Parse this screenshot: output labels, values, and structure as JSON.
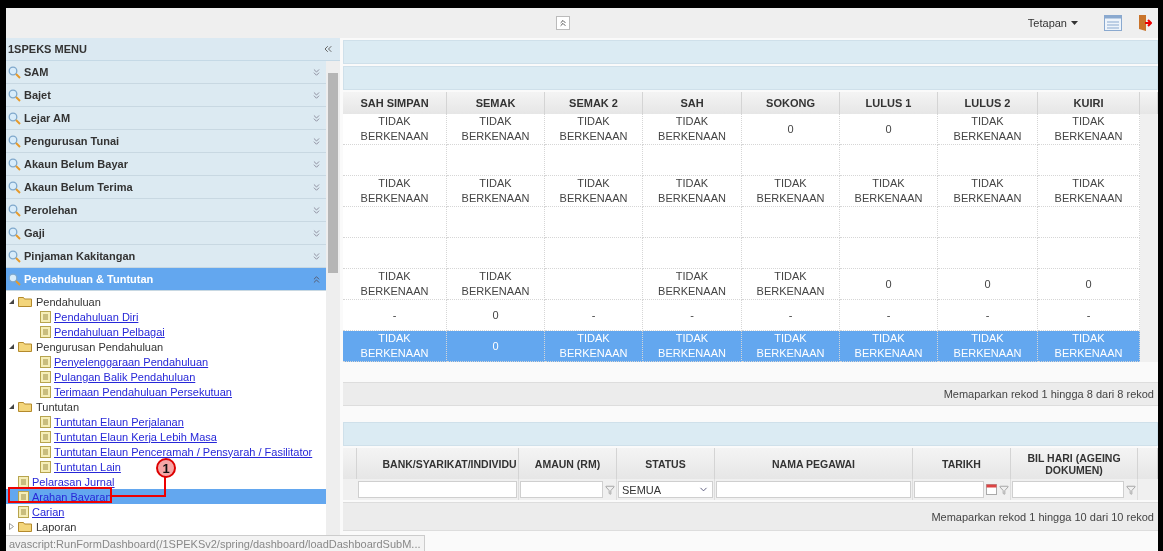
{
  "topbar": {
    "settings_label": "Tetapan"
  },
  "sidebar": {
    "title": "1SPEKS MENU",
    "menu": [
      {
        "label": "SAM",
        "expanded": false
      },
      {
        "label": "Bajet",
        "expanded": false
      },
      {
        "label": "Lejar AM",
        "expanded": false
      },
      {
        "label": "Pengurusan Tunai",
        "expanded": false
      },
      {
        "label": "Akaun Belum Bayar",
        "expanded": false
      },
      {
        "label": "Akaun Belum Terima",
        "expanded": false
      },
      {
        "label": "Perolehan",
        "expanded": false
      },
      {
        "label": "Gaji",
        "expanded": false
      },
      {
        "label": "Pinjaman Kakitangan",
        "expanded": false
      },
      {
        "label": "Pendahuluan & Tuntutan",
        "expanded": true
      }
    ],
    "tree": [
      {
        "kind": "folder",
        "label": "Pendahuluan",
        "expanded": true,
        "children": [
          {
            "kind": "page",
            "label": "Pendahuluan Diri",
            "selected": false,
            "annotated": false
          },
          {
            "kind": "page",
            "label": "Pendahuluan Pelbagai",
            "selected": false,
            "annotated": false
          }
        ]
      },
      {
        "kind": "folder",
        "label": "Pengurusan Pendahuluan",
        "expanded": true,
        "children": [
          {
            "kind": "page",
            "label": "Penyelenggaraan Pendahuluan",
            "selected": false,
            "annotated": false
          },
          {
            "kind": "page",
            "label": "Pulangan Balik Pendahuluan",
            "selected": false,
            "annotated": false
          },
          {
            "kind": "page",
            "label": "Terimaan Pendahuluan Persekutuan",
            "selected": false,
            "annotated": false
          }
        ]
      },
      {
        "kind": "folder",
        "label": "Tuntutan",
        "expanded": true,
        "children": [
          {
            "kind": "page",
            "label": "Tuntutan Elaun Perjalanan",
            "selected": false,
            "annotated": false
          },
          {
            "kind": "page",
            "label": "Tuntutan Elaun Kerja Lebih Masa",
            "selected": false,
            "annotated": false
          },
          {
            "kind": "page",
            "label": "Tuntutan Elaun Penceramah / Pensyarah / Fasilitator",
            "selected": false,
            "annotated": false
          },
          {
            "kind": "page",
            "label": "Tuntutan Lain",
            "selected": false,
            "annotated": false
          }
        ]
      },
      {
        "kind": "page",
        "label": "Pelarasan Jurnal",
        "selected": false,
        "annotated": false
      },
      {
        "kind": "page",
        "label": "Arahan Bayaran",
        "selected": true,
        "annotated": true
      },
      {
        "kind": "page",
        "label": "Carian",
        "selected": false,
        "annotated": false
      },
      {
        "kind": "folder",
        "label": "Laporan",
        "expanded": false
      }
    ],
    "annotation_label": "1",
    "status_text": "avascript:RunFormDashboard(/1SPEKSv2/spring/dashboard/loadDashboardSubM..."
  },
  "table1": {
    "columns": [
      "SAH SIMPAN",
      "SEMAK",
      "SEMAK 2",
      "SAH",
      "SOKONG",
      "LULUS 1",
      "LULUS 2",
      "KUIRI"
    ],
    "rows": [
      {
        "selected": false,
        "cells": [
          "TIDAK BERKENAAN",
          "TIDAK BERKENAAN",
          "TIDAK BERKENAAN",
          "TIDAK BERKENAAN",
          "0",
          "0",
          "TIDAK BERKENAAN",
          "TIDAK BERKENAAN"
        ]
      },
      {
        "selected": false,
        "cells": [
          null,
          null,
          null,
          null,
          null,
          null,
          null,
          null
        ]
      },
      {
        "selected": false,
        "cells": [
          "TIDAK BERKENAAN",
          "TIDAK BERKENAAN",
          "TIDAK BERKENAAN",
          "TIDAK BERKENAAN",
          "TIDAK BERKENAAN",
          "TIDAK BERKENAAN",
          "TIDAK BERKENAAN",
          "TIDAK BERKENAAN"
        ]
      },
      {
        "selected": false,
        "cells": [
          null,
          null,
          null,
          null,
          null,
          null,
          null,
          null
        ]
      },
      {
        "selected": false,
        "cells": [
          null,
          null,
          null,
          null,
          null,
          null,
          null,
          null
        ]
      },
      {
        "selected": false,
        "cells": [
          "TIDAK BERKENAAN",
          "TIDAK BERKENAAN",
          null,
          "TIDAK BERKENAAN",
          "TIDAK BERKENAAN",
          "0",
          "0",
          "0"
        ]
      },
      {
        "selected": false,
        "cells": [
          "-",
          "0",
          "-",
          "-",
          "-",
          "-",
          "-",
          "-"
        ]
      },
      {
        "selected": true,
        "cells": [
          "TIDAK BERKENAAN",
          "0",
          "TIDAK BERKENAAN",
          "TIDAK BERKENAAN",
          "TIDAK BERKENAAN",
          "TIDAK BERKENAAN",
          "TIDAK BERKENAAN",
          "TIDAK BERKENAAN"
        ]
      }
    ],
    "footer": "Memaparkan rekod 1 hingga 8 dari 8 rekod"
  },
  "table2": {
    "columns": [
      "BANK/SYARIKAT/INDIVIDU",
      "AMAUN (RM)",
      "STATUS",
      "NAMA PEGAWAI",
      "TARIKH",
      "BIL HARI (AGEING DOKUMEN)"
    ],
    "filters": [
      {
        "kind": "text"
      },
      {
        "kind": "filter"
      },
      {
        "kind": "select",
        "value": "SEMUA"
      },
      {
        "kind": "text"
      },
      {
        "kind": "date"
      },
      {
        "kind": "filter"
      }
    ],
    "footer": "Memaparkan rekod 1 hingga 10 dari 10 rekod"
  }
}
